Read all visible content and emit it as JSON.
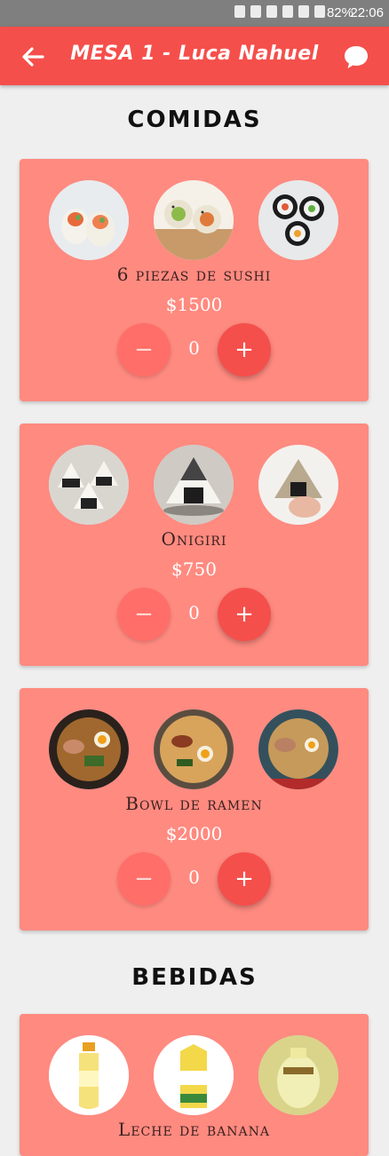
{
  "status_bar": {
    "battery": "82%",
    "time": "22:06"
  },
  "app_bar": {
    "title": "MESA 1 - Luca Nahuel"
  },
  "sections": [
    {
      "title": "COMIDAS"
    },
    {
      "title": "BEBIDAS"
    }
  ],
  "items": [
    {
      "name": "6 piezas de sushi",
      "price": "$1500",
      "quantity": "0",
      "minus": "−",
      "plus": "+"
    },
    {
      "name": "Onigiri",
      "price": "$750",
      "quantity": "0",
      "minus": "−",
      "plus": "+"
    },
    {
      "name": "Bowl de ramen",
      "price": "$2000",
      "quantity": "0",
      "minus": "−",
      "plus": "+"
    },
    {
      "name": "Leche de banana"
    }
  ],
  "colors": {
    "app_bar": "#f54f4b",
    "card": "#ff8a80",
    "plus_button": "#f54f4b",
    "minus_button": "#ff6e68",
    "background": "#efefef"
  }
}
